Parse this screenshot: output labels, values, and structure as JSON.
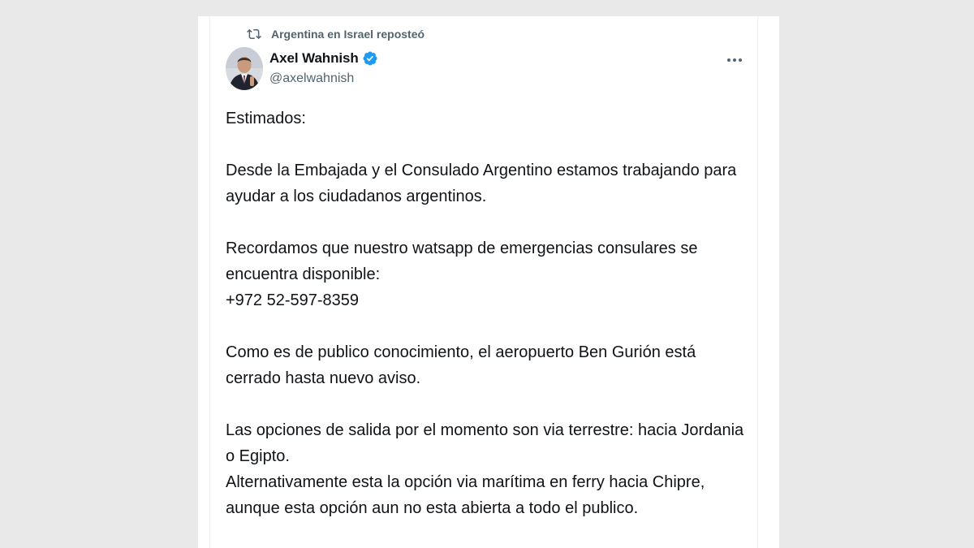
{
  "repost": {
    "text": "Argentina en Israel reposteó",
    "icon": "repost-icon"
  },
  "author": {
    "display_name": "Axel Wahnish",
    "handle": "@axelwahnish",
    "verified": true,
    "verified_color": "#1d9bf0",
    "avatar_icon": "avatar"
  },
  "menu": {
    "icon": "more-horizontal-icon"
  },
  "tweet": {
    "paragraphs": [
      {
        "lines": [
          "Estimados:"
        ]
      },
      {
        "lines": [
          "Desde la Embajada y el Consulado Argentino estamos trabajando para",
          "ayudar a los ciudadanos argentinos."
        ]
      },
      {
        "lines": [
          "Recordamos que nuestro watsapp de emergencias consulares se",
          "encuentra disponible:",
          "+972 52-597-8359"
        ]
      },
      {
        "lines": [
          "Como es de publico conocimiento,  el aeropuerto Ben Gurión está",
          "cerrado hasta nuevo aviso."
        ]
      },
      {
        "lines": [
          "Las opciones de salida por el momento son via  terrestre: hacia Jordania",
          "o Egipto.",
          "Alternativamente esta la opción via marítima en ferry hacia Chipre,",
          "aunque esta opción aun no esta abierta a todo el publico."
        ]
      }
    ]
  }
}
